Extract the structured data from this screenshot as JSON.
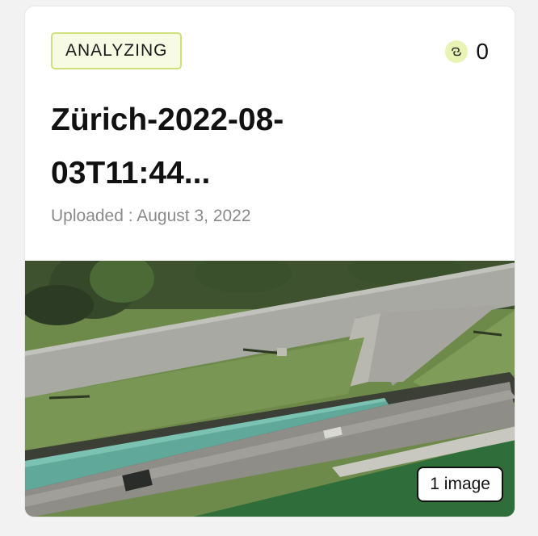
{
  "card": {
    "status": "ANALYZING",
    "count_icon": "link-icon",
    "count": "0",
    "title": "Zürich-2022-08-03T11:44...",
    "uploaded": "Uploaded : August 3, 2022",
    "image_count": "1 image"
  },
  "colors": {
    "badge_bg": "#f7fbe3",
    "badge_border": "#cfe07a",
    "icon_bg": "#e8f3b4"
  }
}
